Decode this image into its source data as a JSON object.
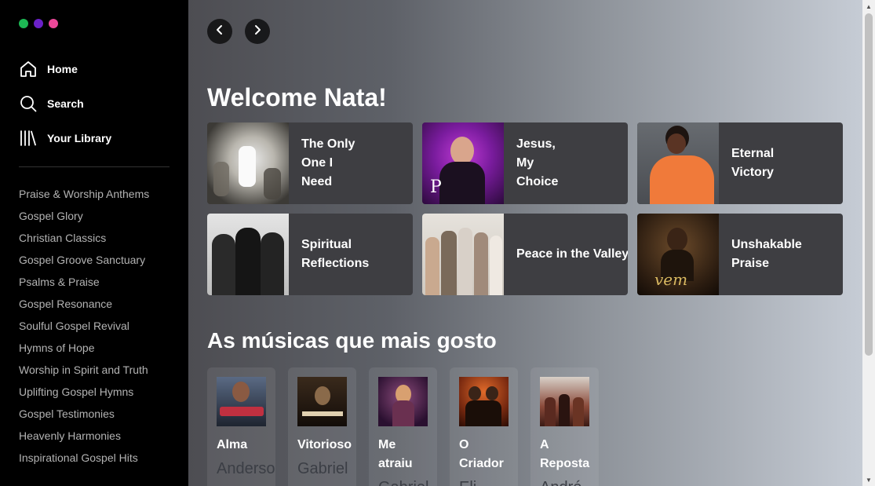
{
  "window_dots": {
    "colors": [
      "#1db954",
      "#6b21c8",
      "#ec4899"
    ]
  },
  "nav": [
    {
      "label": "Home",
      "icon": "home-icon"
    },
    {
      "label": "Search",
      "icon": "search-icon"
    },
    {
      "label": "Your Library",
      "icon": "library-icon"
    }
  ],
  "playlists": [
    "Praise & Worship Anthems",
    "Gospel Glory",
    "Christian Classics",
    "Gospel Groove Sanctuary",
    "Psalms & Praise",
    "Gospel Resonance",
    "Soulful Gospel Revival",
    "Hymns of Hope",
    "Worship in Spirit and Truth",
    "Uplifting Gospel Hymns",
    "Gospel Testimonies",
    "Heavenly Harmonies",
    "Inspirational Gospel Hits"
  ],
  "header": {
    "back_icon": "chevron-left-icon",
    "forward_icon": "chevron-right-icon"
  },
  "welcome": {
    "title": "Welcome Nata!"
  },
  "quick_picks": [
    {
      "title": "The Only One I Need"
    },
    {
      "title": "Jesus, My Choice"
    },
    {
      "title": "Eternal Victory"
    },
    {
      "title": "Spiritual Reflections"
    },
    {
      "title": "Peace in the Valley"
    },
    {
      "title": "Unshakable Praise"
    }
  ],
  "favorites": {
    "title": "As músicas que mais gosto",
    "items": [
      {
        "title": "Alma",
        "artist": "Anderson"
      },
      {
        "title": "Vitorioso",
        "artist": "Gabriel"
      },
      {
        "title": "Me atraiu",
        "artist": "Gabriel"
      },
      {
        "title": "O Criador",
        "artist": "Eli"
      },
      {
        "title": "A Reposta",
        "artist": "André"
      }
    ]
  },
  "scrollbar": {
    "up_icon": "scroll-up-icon",
    "down_icon": "scroll-down-icon"
  }
}
